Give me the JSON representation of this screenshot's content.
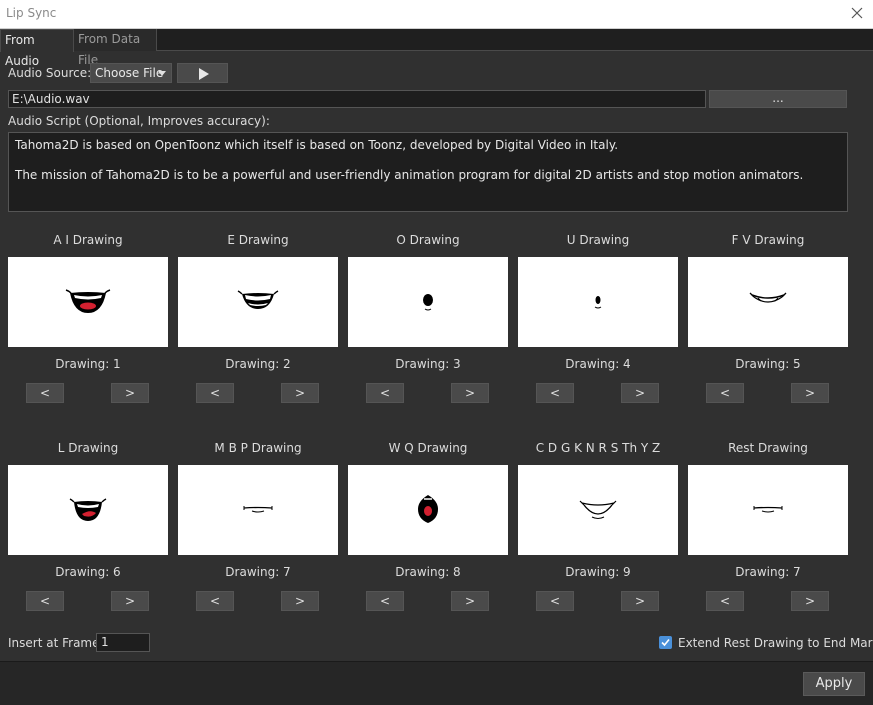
{
  "window": {
    "title": "Lip Sync"
  },
  "tabs": [
    {
      "label": "From Audio",
      "active": true
    },
    {
      "label": "From Data File",
      "active": false
    }
  ],
  "audio": {
    "source_label": "Audio Source:",
    "source_value": "Choose File",
    "path_value": "E:\\Audio.wav",
    "browse_label": "...",
    "script_label": "Audio Script (Optional, Improves accuracy):",
    "script_lines": [
      "Tahoma2D is based on OpenToonz which itself is based on Toonz, developed by Digital Video in Italy.",
      "The mission of Tahoma2D is to be a powerful and user-friendly animation program for digital 2D artists and stop motion animators."
    ]
  },
  "drawings": [
    {
      "name": "A I Drawing",
      "drawing": "Drawing: 1",
      "shape": "open-smile",
      "prev": "<",
      "next": ">"
    },
    {
      "name": "E Drawing",
      "drawing": "Drawing: 2",
      "shape": "smile-teeth",
      "prev": "<",
      "next": ">"
    },
    {
      "name": "O Drawing",
      "drawing": "Drawing: 3",
      "shape": "round-small",
      "prev": "<",
      "next": ">"
    },
    {
      "name": "U Drawing",
      "drawing": "Drawing: 4",
      "shape": "round-tiny",
      "prev": "<",
      "next": ">"
    },
    {
      "name": "F V Drawing",
      "drawing": "Drawing: 5",
      "shape": "bite-lip",
      "prev": "<",
      "next": ">"
    },
    {
      "name": "L Drawing",
      "drawing": "Drawing: 6",
      "shape": "tongue",
      "prev": "<",
      "next": ">"
    },
    {
      "name": "M B P Drawing",
      "drawing": "Drawing: 7",
      "shape": "closed",
      "prev": "<",
      "next": ">"
    },
    {
      "name": "W Q Drawing",
      "drawing": "Drawing: 8",
      "shape": "pucker",
      "prev": "<",
      "next": ">"
    },
    {
      "name": "C D G K N R S Th Y Z",
      "drawing": "Drawing: 9",
      "shape": "wide-smile",
      "prev": "<",
      "next": ">"
    },
    {
      "name": "Rest Drawing",
      "drawing": "Drawing: 7",
      "shape": "closed",
      "prev": "<",
      "next": ">"
    }
  ],
  "insert": {
    "label": "Insert at Frame:",
    "value": "1"
  },
  "extend": {
    "label": "Extend Rest Drawing to End Marker",
    "checked": true
  },
  "apply_label": "Apply",
  "colors": {
    "background": "#303030",
    "field": "#1e1e1e",
    "button": "#4a4a4a",
    "accent": "#4a90d9"
  }
}
